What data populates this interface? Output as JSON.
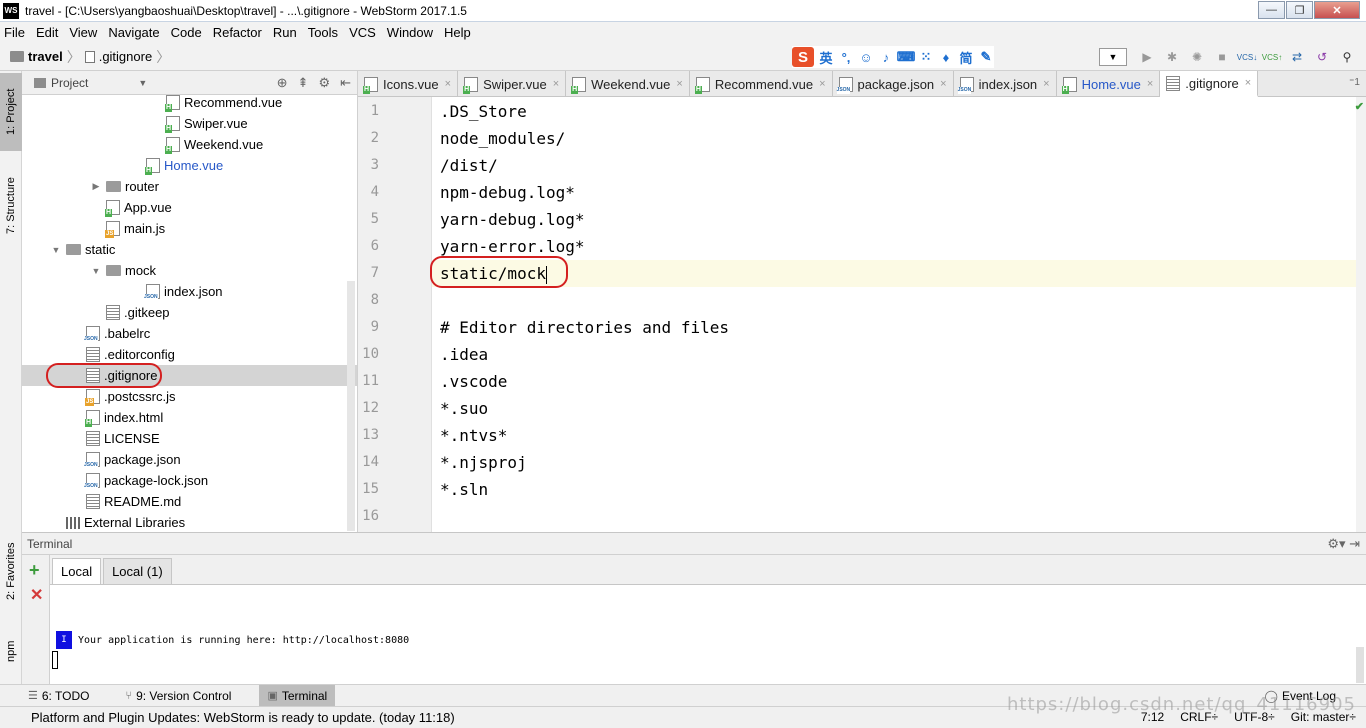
{
  "window": {
    "title": "travel - [C:\\Users\\yangbaoshuai\\Desktop\\travel] - ...\\.gitignore - WebStorm 2017.1.5",
    "logo": "WS",
    "minimize": "—",
    "maximize": "❐",
    "close": "✕"
  },
  "menu": [
    "File",
    "Edit",
    "View",
    "Navigate",
    "Code",
    "Refactor",
    "Run",
    "Tools",
    "VCS",
    "Window",
    "Help"
  ],
  "breadcrumb": {
    "project": "travel",
    "file": ".gitignore"
  },
  "ime": {
    "logo": "S",
    "lang": "英"
  },
  "project_panel": {
    "title": "Project"
  },
  "side_tabs": {
    "project": "1: Project",
    "structure": "7: Structure",
    "favorites": "2: Favorites",
    "npm": "npm"
  },
  "tree": [
    {
      "label": "Recommend.vue",
      "type": "vue",
      "indent": 6
    },
    {
      "label": "Swiper.vue",
      "type": "vue",
      "indent": 6
    },
    {
      "label": "Weekend.vue",
      "type": "vue",
      "indent": 6
    },
    {
      "label": "Home.vue",
      "type": "vue",
      "indent": 5,
      "blue": true
    },
    {
      "label": "router",
      "type": "folder",
      "indent": 3,
      "arrow": "▶"
    },
    {
      "label": "App.vue",
      "type": "vue",
      "indent": 3
    },
    {
      "label": "main.js",
      "type": "js",
      "indent": 3
    },
    {
      "label": "static",
      "type": "folder",
      "indent": 1,
      "arrow": "▼"
    },
    {
      "label": "mock",
      "type": "folder",
      "indent": 3,
      "arrow": "▼"
    },
    {
      "label": "index.json",
      "type": "json",
      "indent": 5
    },
    {
      "label": ".gitkeep",
      "type": "txt",
      "indent": 3
    },
    {
      "label": ".babelrc",
      "type": "json",
      "indent": 2
    },
    {
      "label": ".editorconfig",
      "type": "txt",
      "indent": 2
    },
    {
      "label": ".gitignore",
      "type": "txt",
      "indent": 2,
      "selected": true
    },
    {
      "label": ".postcssrc.js",
      "type": "js",
      "indent": 2
    },
    {
      "label": "index.html",
      "type": "vue",
      "indent": 2
    },
    {
      "label": "LICENSE",
      "type": "txt",
      "indent": 2
    },
    {
      "label": "package.json",
      "type": "json",
      "indent": 2
    },
    {
      "label": "package-lock.json",
      "type": "json",
      "indent": 2
    },
    {
      "label": "README.md",
      "type": "txt",
      "indent": 2
    },
    {
      "label": "External Libraries",
      "type": "lib",
      "indent": 1
    }
  ],
  "tabs": [
    {
      "label": "Icons.vue",
      "type": "vue"
    },
    {
      "label": "Swiper.vue",
      "type": "vue"
    },
    {
      "label": "Weekend.vue",
      "type": "vue"
    },
    {
      "label": "Recommend.vue",
      "type": "vue"
    },
    {
      "label": "package.json",
      "type": "json"
    },
    {
      "label": "index.json",
      "type": "json"
    },
    {
      "label": "Home.vue",
      "type": "vue",
      "blue": true
    },
    {
      "label": ".gitignore",
      "type": "txt",
      "active": true
    }
  ],
  "tab_close": "×",
  "tabs_overflow": "⁼1",
  "code_lines": [
    ".DS_Store",
    "node_modules/",
    "/dist/",
    "npm-debug.log*",
    "yarn-debug.log*",
    "yarn-error.log*",
    "static/mock",
    "",
    "# Editor directories and files",
    ".idea",
    ".vscode",
    "*.suo",
    "*.ntvs*",
    "*.njsproj",
    "*.sln",
    ""
  ],
  "current_line": 7,
  "terminal": {
    "title": "Terminal",
    "tabs": [
      "Local",
      "Local (1)"
    ],
    "badge": "I",
    "output": "Your application is running here: http://localhost:8080"
  },
  "bottom_tools": [
    {
      "label": "6: TODO",
      "icon": "☰"
    },
    {
      "label": "9: Version Control",
      "icon": "⑂"
    },
    {
      "label": "Terminal",
      "icon": "▣",
      "active": true
    }
  ],
  "event_log": "Event Log",
  "status": {
    "message": "Platform and Plugin Updates: WebStorm is ready to update. (today 11:18)",
    "position": "7:12",
    "line_sep": "CRLF÷",
    "encoding": "UTF-8÷",
    "vcs": "Git: master÷"
  },
  "watermark": "https://blog.csdn.net/qq_41116905"
}
